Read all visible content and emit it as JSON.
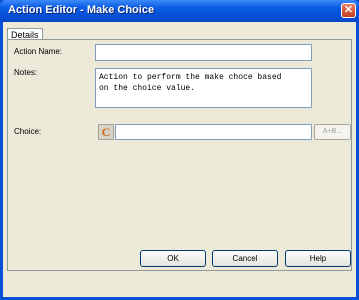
{
  "window": {
    "title": "Action Editor - Make Choice",
    "close_glyph": "✕"
  },
  "tabs": [
    {
      "label": "Details"
    }
  ],
  "form": {
    "action_name_label": "Action Name:",
    "action_name_value": "",
    "notes_label": "Notes:",
    "notes_value": "Action to perform the make choce based\non the choice value.",
    "choice_label": "Choice:",
    "choice_icon": "C",
    "choice_value": "",
    "choice_button_label": "A+B..."
  },
  "buttons": {
    "ok": "OK",
    "cancel": "Cancel",
    "help": "Help"
  },
  "colors": {
    "titlebar": "#0a5be6",
    "client_bg": "#ece9d8",
    "choice_icon_color": "#d4681a"
  }
}
